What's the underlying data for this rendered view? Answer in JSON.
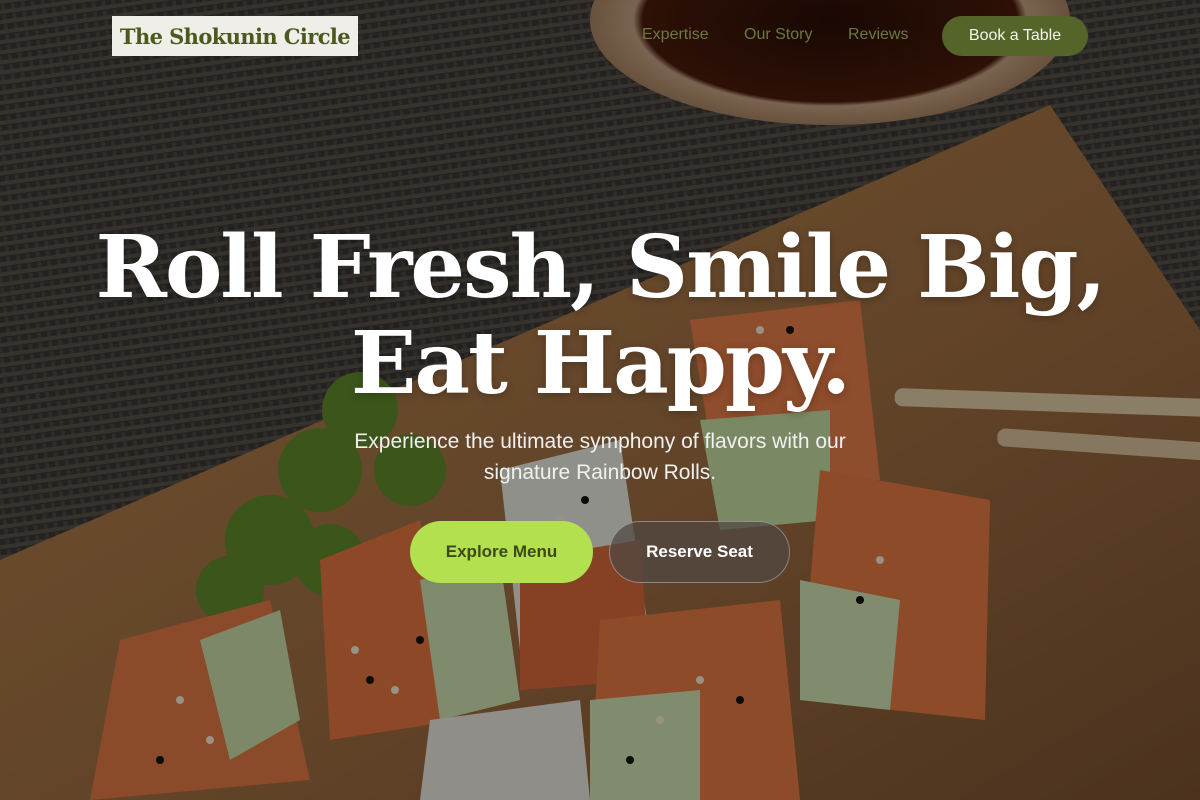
{
  "brand": {
    "logo_text": "The Shokunin Circle"
  },
  "nav": {
    "links": [
      "Expertise",
      "Our Story",
      "Reviews"
    ],
    "cta_label": "Book a Table"
  },
  "hero": {
    "headline_line1": "Roll Fresh, Smile Big,",
    "headline_line2": "Eat Happy.",
    "subtext_line1": "Experience the ultimate symphony of flavors with our",
    "subtext_line2": "signature Rainbow Rolls.",
    "primary_button": "Explore Menu",
    "secondary_button": "Reserve Seat"
  },
  "colors": {
    "brand_green": "#55652a",
    "accent_lime": "#b3e04e",
    "logo_bg": "#efeee9",
    "nav_text": "#6a7a3a"
  }
}
